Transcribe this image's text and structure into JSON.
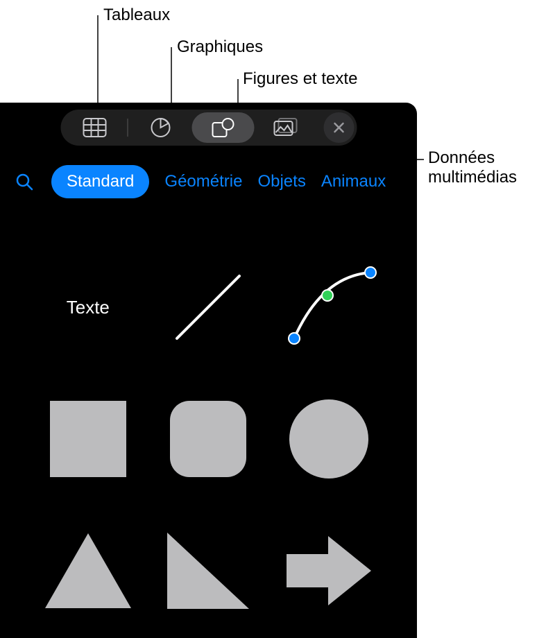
{
  "callouts": {
    "tables": "Tableaux",
    "charts": "Graphiques",
    "shapes_text": "Figures et texte",
    "media": "Données\nmultimédias"
  },
  "toolbar": {
    "tables_icon": "table-icon",
    "charts_icon": "piechart-icon",
    "shapes_icon": "shapes-icon",
    "media_icon": "image-icon",
    "close_icon": "close-icon",
    "active": "shapes"
  },
  "categories": {
    "search_icon": "search-icon",
    "standard": "Standard",
    "geometry": "Géométrie",
    "objects": "Objets",
    "animals": "Animaux"
  },
  "shapes": {
    "text_label": "Texte",
    "items": [
      "text",
      "line",
      "curve",
      "square",
      "rounded-square",
      "circle",
      "triangle",
      "right-triangle",
      "arrow-right"
    ]
  },
  "colors": {
    "accent": "#0a84ff",
    "shape_fill": "#bcbcbe",
    "panel_bg": "#000000"
  }
}
